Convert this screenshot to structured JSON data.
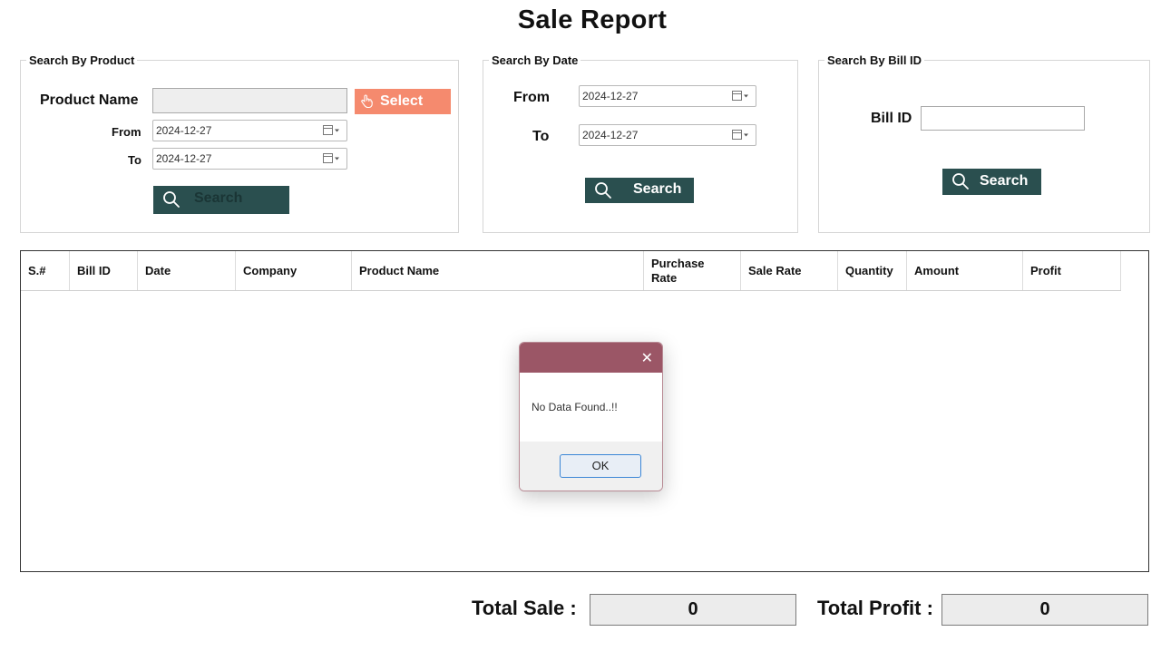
{
  "page_title": "Sale Report",
  "product_group": {
    "legend": "Search By Product",
    "product_name_label": "Product Name",
    "select_label": "Select",
    "from_label": "From",
    "from_value": "2024-12-27",
    "to_label": "To",
    "to_value": "2024-12-27",
    "search_label": "Search"
  },
  "date_group": {
    "legend": "Search By Date",
    "from_label": "From",
    "from_value": "2024-12-27",
    "to_label": "To",
    "to_value": "2024-12-27",
    "search_label": "Search"
  },
  "bill_group": {
    "legend": "Search By Bill ID",
    "bill_id_label": "Bill ID",
    "search_label": "Search"
  },
  "table": {
    "columns": [
      "S.#",
      "Bill ID",
      "Date",
      "Company",
      "Product Name",
      "Purchase Rate",
      "Sale Rate",
      "Quantity",
      "Amount",
      "Profit"
    ],
    "rows": []
  },
  "dialog": {
    "message": "No Data Found..!!",
    "ok_label": "OK",
    "close_glyph": "✕"
  },
  "totals": {
    "total_sale_label": "Total Sale :",
    "total_sale_value": "0",
    "total_profit_label": "Total Profit :",
    "total_profit_value": "0"
  },
  "colors": {
    "search_button": "#2a4f4f",
    "select_button": "#f58a6e",
    "dialog_titlebar": "#9b5666"
  },
  "icons": [
    "search-icon",
    "hand-pointer-icon",
    "calendar-icon",
    "close-icon"
  ]
}
